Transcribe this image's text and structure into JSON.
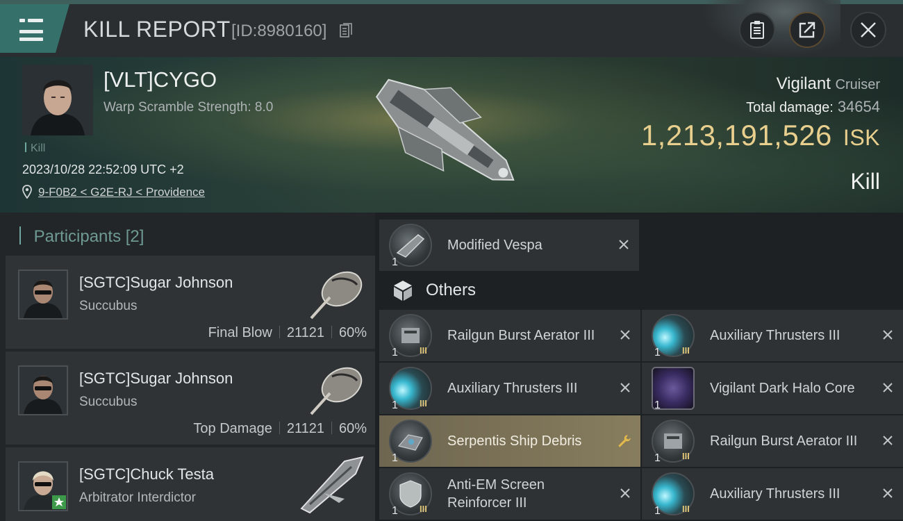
{
  "header": {
    "title": "KILL REPORT",
    "report_id": "[ID:8980160]"
  },
  "victim": {
    "name": "[VLT]CYGO",
    "warp_scramble": "Warp Scramble Strength: 8.0",
    "kill_tag": "Kill",
    "datetime": "2023/10/28 22:52:09 UTC +2",
    "location": "9-F0B2 < G2E-RJ < Providence",
    "ship_name": "Vigilant",
    "ship_class": "Cruiser",
    "total_damage_label": "Total damage:",
    "total_damage": "34654",
    "isk_value": "1,213,191,526",
    "isk_unit": "ISK",
    "result": "Kill"
  },
  "participants": {
    "header": "Participants",
    "count": "[2]",
    "rows": [
      {
        "name": "[SGTC]Sugar Johnson",
        "ship": "Succubus",
        "role": "Final Blow",
        "damage": "21121",
        "percent": "60%"
      },
      {
        "name": "[SGTC]Sugar Johnson",
        "ship": "Succubus",
        "role": "Top Damage",
        "damage": "21121",
        "percent": "60%"
      },
      {
        "name": "[SGTC]Chuck Testa",
        "ship": "Arbitrator Interdictor"
      }
    ]
  },
  "items": {
    "top": {
      "name": "Modified Vespa",
      "qty": "1"
    },
    "others_label": "Others",
    "left": [
      {
        "name": "Railgun Burst Aerator III",
        "qty": "1",
        "meta": "III"
      },
      {
        "name": "Auxiliary Thrusters III",
        "qty": "1",
        "meta": "III"
      },
      {
        "name": "Serpentis Ship Debris",
        "qty": "1"
      },
      {
        "name": "Anti-EM Screen Reinforcer III",
        "qty": "1",
        "meta": "III"
      }
    ],
    "right": [
      {
        "name": "Auxiliary Thrusters III",
        "qty": "1",
        "meta": "III"
      },
      {
        "name": "Vigilant Dark Halo Core",
        "qty": "1"
      },
      {
        "name": "Railgun Burst Aerator III",
        "qty": "1",
        "meta": "III"
      },
      {
        "name": "Auxiliary Thrusters III",
        "qty": "1",
        "meta": "III"
      }
    ]
  },
  "colors": {
    "accent_teal": "#35706a",
    "isk_gold": "#e9cf8e",
    "highlight_row": "#877d5e"
  },
  "icons": [
    "menu-icon",
    "copy-icon",
    "clipboard-icon",
    "share-icon",
    "close-icon",
    "pin-icon",
    "cube-icon",
    "remove-icon",
    "wrench-icon"
  ]
}
